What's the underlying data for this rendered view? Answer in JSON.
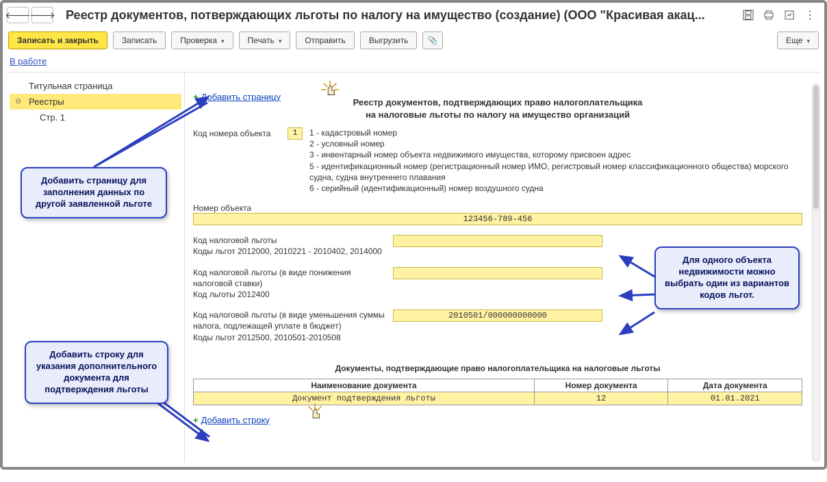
{
  "window": {
    "title": "Реестр документов, потверждающих льготы по налогу на имущество (создание) (ООО \"Красивая акац..."
  },
  "toolbar": {
    "save_close": "Записать и закрыть",
    "save": "Записать",
    "check": "Проверка",
    "print": "Печать",
    "send": "Отправить",
    "export": "Выгрузить",
    "more": "Еще"
  },
  "status": {
    "label": "В работе"
  },
  "sidebar": {
    "items": [
      {
        "label": "Титульная страница"
      },
      {
        "label": "Реестры"
      },
      {
        "label": "Стр. 1"
      }
    ]
  },
  "content": {
    "add_page": "Добавить страницу",
    "heading_line1": "Реестр документов, подтверждающих право налогоплательщика",
    "heading_line2": "на налоговые льготы по налогу на имущество организаций",
    "code": {
      "label": "Код номера объекта",
      "value": "1",
      "options": [
        "1 - кадастровый номер",
        "2 - условный номер",
        "3 - инвентарный номер объекта недвижимого имущества, которому присвоен адрес",
        "5 - идентификационный номер (регистрационный номер ИМО, регистровый номер классификационного общества) морского судна, судна внутреннего плавания",
        "6 - серийный (идентификационный) номер воздушного судна"
      ]
    },
    "object_number": {
      "label": "Номер объекта",
      "value": "123456-789-456"
    },
    "tax_codes": [
      {
        "title": "Код налоговой льготы",
        "sub": "Коды льгот 2012000, 2010221 - 2010402, 2014000",
        "value": ""
      },
      {
        "title": "Код налоговой льготы (в виде понижения налоговой ставки)",
        "sub": "Код льготы 2012400",
        "value": ""
      },
      {
        "title": "Код налоговой льготы (в виде уменьшения суммы налога, подлежащей уплате в бюджет)",
        "sub": "Коды льгот 2012500, 2010501-2010508",
        "value": "2010501/000000000000"
      }
    ],
    "docs": {
      "heading": "Документы, подтверждающие право налогоплательщика на налоговые льготы",
      "columns": [
        "Наименование документа",
        "Номер документа",
        "Дата документа"
      ],
      "rows": [
        {
          "name": "Документ подтверждения льготы",
          "num": "12",
          "date": "01.01.2021"
        }
      ],
      "add_row": "Добавить строку"
    }
  },
  "callouts": {
    "add_page": "Добавить страницу для заполнения данных по другой заявленной льготе",
    "add_row": "Добавить строку для указания дополнительного документа для подтверждения льготы",
    "variants": "Для одного объекта недвижимости можно выбрать один из вариантов кодов льгот."
  }
}
